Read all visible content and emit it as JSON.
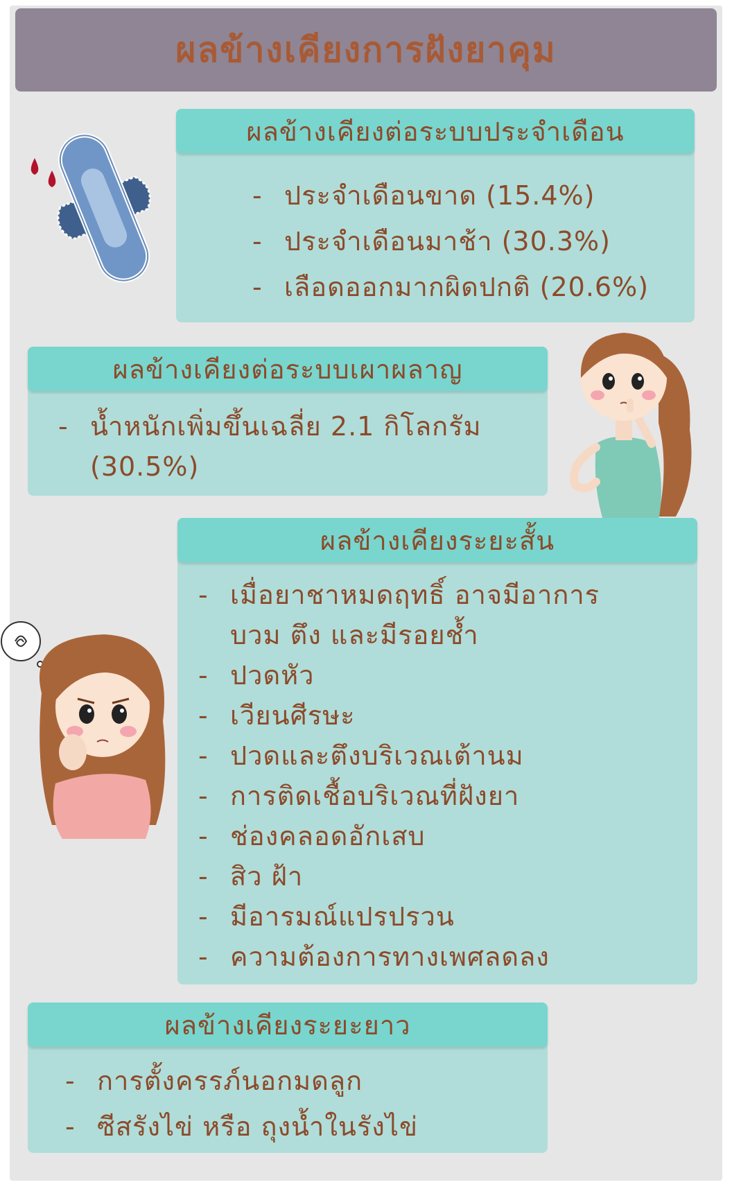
{
  "title": "ผลข้างเคียงการฝังยาคุม",
  "sections": {
    "menstrual": {
      "heading": "ผลข้างเคียงต่อระบบประจำเดือน",
      "items": [
        "ประจำเดือนขาด (15.4%)",
        "ประจำเดือนมาช้า (30.3%)",
        "เลือดออกมากผิดปกติ (20.6%)"
      ]
    },
    "metabolic": {
      "heading": "ผลข้างเคียงต่อระบบเผาผลาญ",
      "items": [
        "น้ำหนักเพิ่มขึ้นเฉลี่ย 2.1 กิโลกรัม (30.5%)"
      ]
    },
    "short_term": {
      "heading": "ผลข้างเคียงระยะสั้น",
      "items": [
        "เมื่อยาชาหมดฤทธิ์ อาจมีอาการ บวม ตึง และมีรอยช้ำ",
        "ปวดหัว",
        "เวียนศีรษะ",
        "ปวดและตึงบริเวณเต้านม",
        "การติดเชื้อบริเวณที่ฝังยา",
        "ช่องคลอดอักเสบ",
        "สิว ฝ้า",
        "มีอารมณ์แปรปรวน",
        "ความต้องการทางเพศลดลง"
      ]
    },
    "long_term": {
      "heading": "ผลข้างเคียงระยะยาว",
      "items": [
        "การตั้งครรภ์นอกมดลูก",
        "ซีสรังไข่ หรือ ถุงน้ำในรังไข่"
      ]
    }
  },
  "icons": {
    "pad": "sanitary-pad-icon",
    "woman_thinking": "woman-thinking-icon",
    "woman_worried": "woman-worried-icon"
  },
  "colors": {
    "title_bg": "#8f8594",
    "title_text": "#a85a35",
    "box_bg": "#b0ddd9",
    "box_head_bg": "#78d6ce",
    "text": "#8c4a2a",
    "page_bg": "#e6e6e6"
  }
}
